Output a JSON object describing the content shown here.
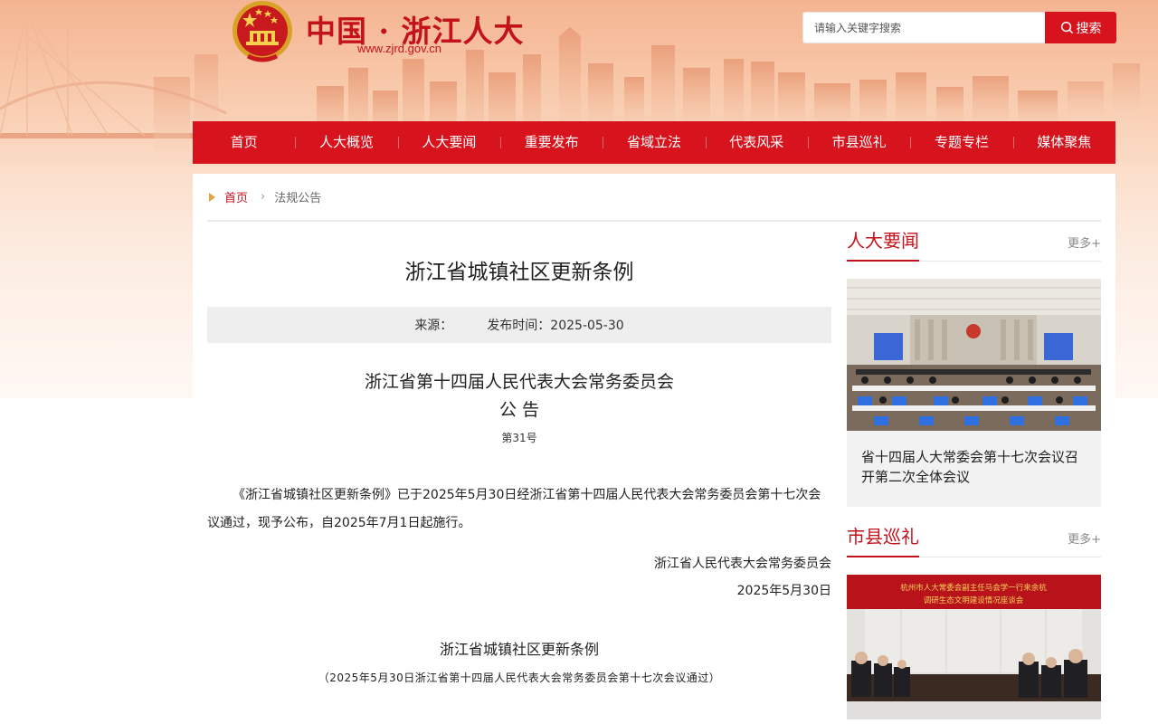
{
  "header": {
    "site_title": "中国 · 浙江人大",
    "site_url": "www.zjrd.gov.cn",
    "emblem_icon": "national-emblem-icon"
  },
  "search": {
    "placeholder": "请输入关键字搜索",
    "button_label": "搜索",
    "icon": "search-icon"
  },
  "nav": {
    "items": [
      "首页",
      "人大概览",
      "人大要闻",
      "重要发布",
      "省域立法",
      "代表风采",
      "市县巡礼",
      "专题专栏",
      "媒体聚焦"
    ]
  },
  "breadcrumb": {
    "home": "首页",
    "current": "法规公告"
  },
  "article": {
    "title": "浙江省城镇社区更新条例",
    "source_label": "来源：",
    "date_label": "发布时间：2025-05-30",
    "notice_org": "浙江省第十四届人民代表大会常务委员会",
    "notice_word": "公 告",
    "notice_no": "第31号",
    "body": "《浙江省城镇社区更新条例》已于2025年5月30日经浙江省第十四届人民代表大会常务委员会第十七次会议通过，现予公布，自2025年7月1日起施行。",
    "sign_org": "浙江省人民代表大会常务委员会",
    "sign_date": "2025年5月30日",
    "reg_title": "浙江省城镇社区更新条例",
    "reg_subtitle": "（2025年5月30日浙江省第十四届人民代表大会常务委员会第十七次会议通过）"
  },
  "sidebar": {
    "news": {
      "title": "人大要闻",
      "more": "更多+",
      "caption": "省十四届人大常委会第十七次会议召开第二次全体会议"
    },
    "city": {
      "title": "市县巡礼",
      "more": "更多+",
      "banner_text_1": "杭州市人大常委会副主任马会学一行来余杭",
      "banner_text_2": "调研生态文明建设情况座谈会"
    }
  },
  "colors": {
    "brand_red": "#d7141d",
    "title_red": "#c4121b",
    "accent_orange": "#e6a23c"
  }
}
